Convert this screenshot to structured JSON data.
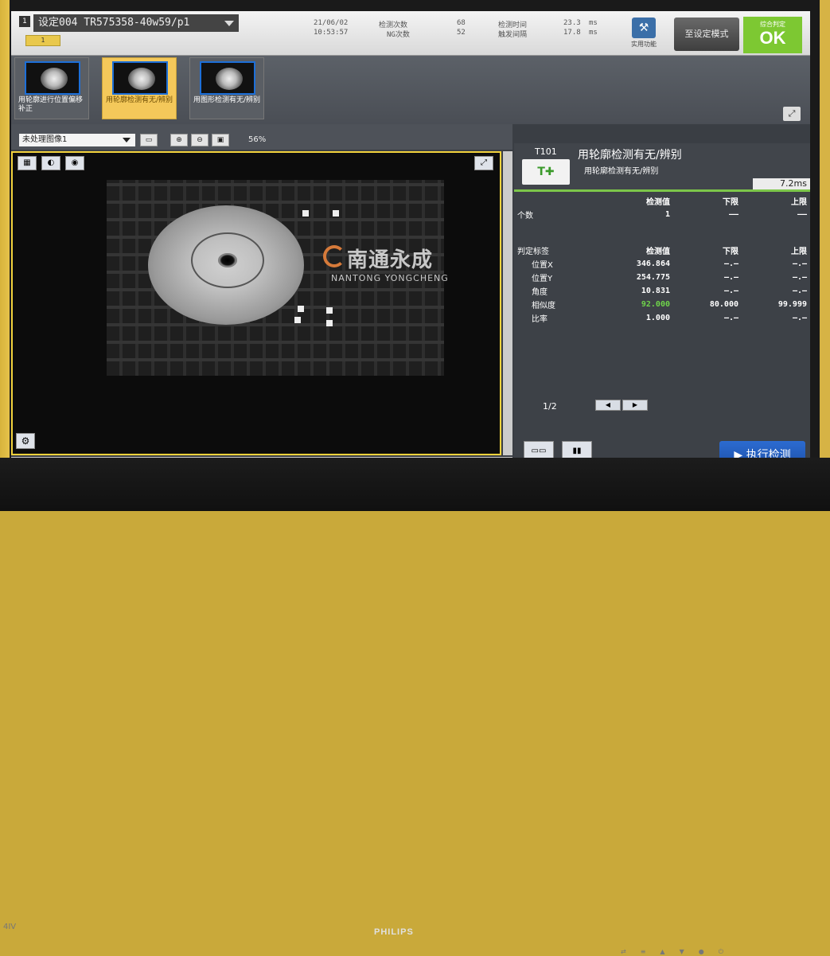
{
  "header": {
    "scene_number": "1",
    "scene_name": "设定004 TR575358-40w59/p1",
    "scene_tab": "1",
    "date": "21/06/02",
    "time": "10:53:57",
    "measure_count_label": "检测次数",
    "measure_count": "68",
    "ng_count_label": "NG次数",
    "ng_count": "52",
    "measure_time_label": "检测时间",
    "measure_time": "23.3",
    "measure_time_unit": "ms",
    "trigger_interval_label": "触发间隔",
    "trigger_interval": "17.8",
    "trigger_interval_unit": "ms",
    "tools_label": "实用功能",
    "setup_mode_label": "至设定模式",
    "overall_label": "综合判定",
    "overall_value": "OK"
  },
  "flow": {
    "units": [
      {
        "label": "用轮廓进行位置偏移补正",
        "selected": false
      },
      {
        "label": "用轮廓检测有无/辨别",
        "selected": true
      },
      {
        "label": "用图形检测有无/辨别",
        "selected": false
      }
    ]
  },
  "image_toolbar": {
    "image_select": "未处理图像1",
    "zoom": "56%"
  },
  "watermark": {
    "zh": "南通永成",
    "en": "NANTONG YONGCHENG"
  },
  "result": {
    "unit_id": "T101",
    "title": "用轮廓检测有无/辨别",
    "subtitle": "用轮廓检测有无/辨别",
    "proc_time": "7.2ms",
    "count_table": {
      "headers": [
        "",
        "检测值",
        "下限",
        "上限"
      ],
      "rows": [
        [
          "个数",
          "1",
          "——",
          "——"
        ]
      ]
    },
    "judge_table": {
      "headers": [
        "判定标签",
        "检测值",
        "下限",
        "上限"
      ],
      "rows": [
        [
          "位置X",
          "346.864",
          "—.—",
          "—.—"
        ],
        [
          "位置Y",
          "254.775",
          "—.—",
          "—.—"
        ],
        [
          "角度",
          "10.831",
          "—.—",
          "—.—"
        ],
        [
          "相似度",
          "92.000",
          "80.000",
          "99.999"
        ],
        [
          "比率",
          "1.000",
          "—.—",
          "—.—"
        ]
      ]
    },
    "page": "1/2"
  },
  "exec_label": "执行检测",
  "monitor": {
    "brand": "PHILIPS",
    "model": "4IV"
  }
}
